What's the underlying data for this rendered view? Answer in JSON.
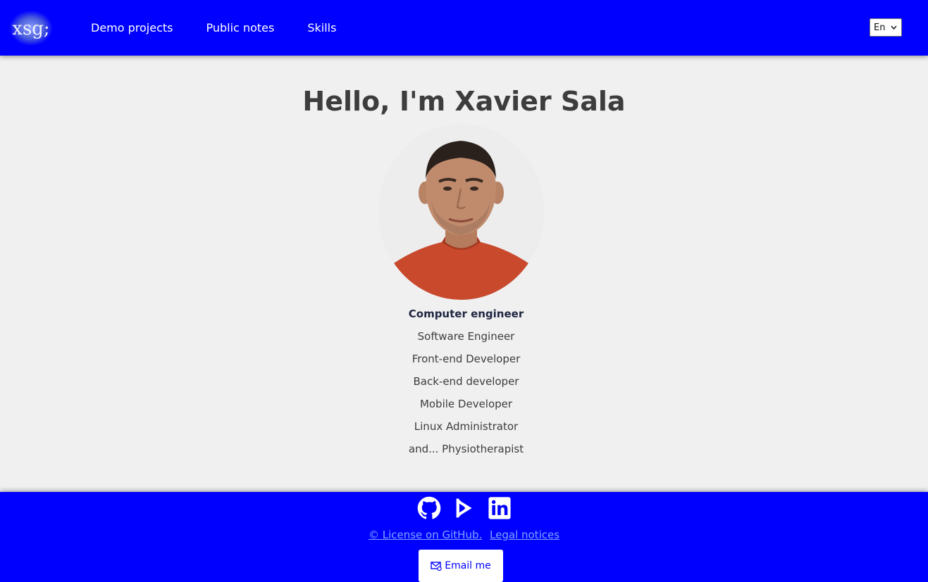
{
  "header": {
    "logo_text": "xsg;",
    "nav": [
      {
        "label": "Demo projects"
      },
      {
        "label": "Public notes"
      },
      {
        "label": "Skills"
      }
    ],
    "language": {
      "selected": "En"
    }
  },
  "main": {
    "title": "Hello, I'm Xavier Sala",
    "roles": [
      "Computer engineer",
      "Software Engineer",
      "Front-end Developer",
      "Back-end developer",
      "Mobile Developer",
      "Linux Administrator",
      "and... Physiotherapist"
    ]
  },
  "footer": {
    "social_icons": [
      "github-icon",
      "google-play-icon",
      "linkedin-icon"
    ],
    "license_link": "© License on GitHub.",
    "legal_link": "Legal notices",
    "email_button": "Email me"
  },
  "colors": {
    "brand_blue": "#0000ff",
    "page_bg": "#f0f0f0",
    "text": "#3d3d3d",
    "link": "#7aa8ff"
  }
}
